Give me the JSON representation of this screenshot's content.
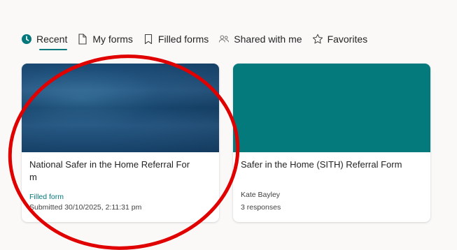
{
  "tabs": [
    {
      "label": "Recent",
      "icon": "clock-icon",
      "active": true
    },
    {
      "label": "My forms",
      "icon": "document-icon",
      "active": false
    },
    {
      "label": "Filled forms",
      "icon": "bookmark-icon",
      "active": false
    },
    {
      "label": "Shared with me",
      "icon": "people-icon",
      "active": false
    },
    {
      "label": "Favorites",
      "icon": "star-icon",
      "active": false
    }
  ],
  "cards": [
    {
      "title": "National Safer in the Home Referral For\nm",
      "status": "Filled form",
      "meta": "Submitted 30/10/2025, 2:11:31 pm"
    },
    {
      "title": "Safer in the Home (SITH) Referral Form",
      "owner": "Kate Bayley",
      "meta": "3 responses"
    }
  ],
  "colors": {
    "accent": "#03787c",
    "annotation": "#e00000",
    "banner2": "#047a7c",
    "banner1": "#1b4f7c"
  }
}
